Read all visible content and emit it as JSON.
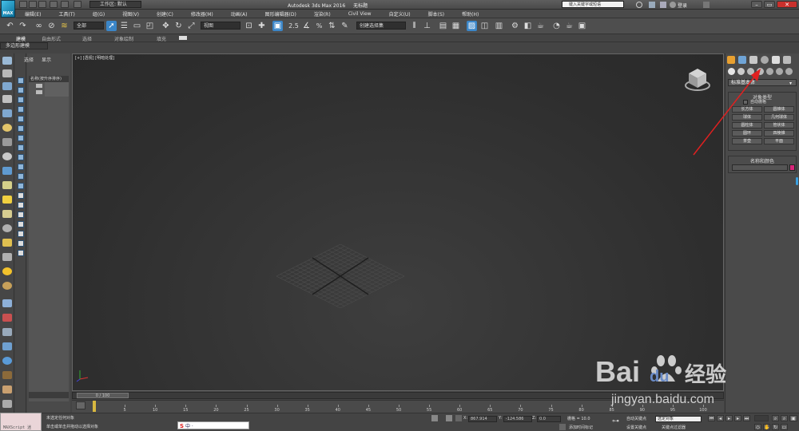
{
  "app": {
    "logo_text": "MAX",
    "workspace": "工作区: 默认",
    "title": "Autodesk 3ds Max 2016",
    "file": "无标题",
    "search_placeholder": "键入关键字或短语",
    "login": "登录"
  },
  "menu": [
    "编辑(E)",
    "工具(T)",
    "组(G)",
    "视图(V)",
    "创建(C)",
    "修改器(M)",
    "动画(A)",
    "图形编辑器(D)",
    "渲染(R)",
    "Civil View",
    "自定义(U)",
    "脚本(S)",
    "帮助(H)"
  ],
  "toolbar": {
    "filter": "全部",
    "ref_coord": "视图",
    "named_selection": "创建选择集"
  },
  "ribbon": {
    "tabs": [
      "建模",
      "自由形式",
      "选择",
      "对象绘制",
      "填充"
    ],
    "sub": "多边形建模"
  },
  "explorer": {
    "tabs": [
      "选择",
      "显示"
    ],
    "header": "名称(按升序排序)"
  },
  "viewport": {
    "label": "[+] [透视] [明暗处理]"
  },
  "timeline": {
    "frame_display": "0 / 100",
    "ticks": [
      "0",
      "5",
      "10",
      "15",
      "20",
      "25",
      "30",
      "35",
      "40",
      "45",
      "50",
      "55",
      "60",
      "65",
      "70",
      "75",
      "80",
      "85",
      "90",
      "95",
      "100"
    ]
  },
  "command_panel": {
    "category": "标准基本体",
    "object_type_title": "对象类型",
    "autogrid": "自动栅格",
    "objects": [
      "长方体",
      "圆锥体",
      "球体",
      "几何球体",
      "圆柱体",
      "管状体",
      "圆环",
      "四棱锥",
      "茶壶",
      "平面"
    ],
    "name_color_title": "名称和颜色",
    "object_color": "#d8257a"
  },
  "status": {
    "maxscript": "MAXScript 迷",
    "message1": "未选定任何对象",
    "message2": "单击或单击并拖动以选择对象",
    "x_label": "X:",
    "x_value": "867.914",
    "y_label": "Y:",
    "y_value": "-124.586",
    "z_label": "Z:",
    "z_value": "0.0",
    "grid": "栅格 = 10.0",
    "add_time_tag": "添加时间标记",
    "auto_key": "自动关键点",
    "selected_dropdown": "选定对象",
    "set_key": "设置关键点",
    "key_filters": "关键点过滤器"
  },
  "watermark": {
    "brand": "Bai",
    "brand2": "du",
    "cn": "经验",
    "url": "jingyan.baidu.com"
  },
  "colors": {
    "accent_red": "#e02020",
    "selected_blue": "#3b86c8"
  }
}
